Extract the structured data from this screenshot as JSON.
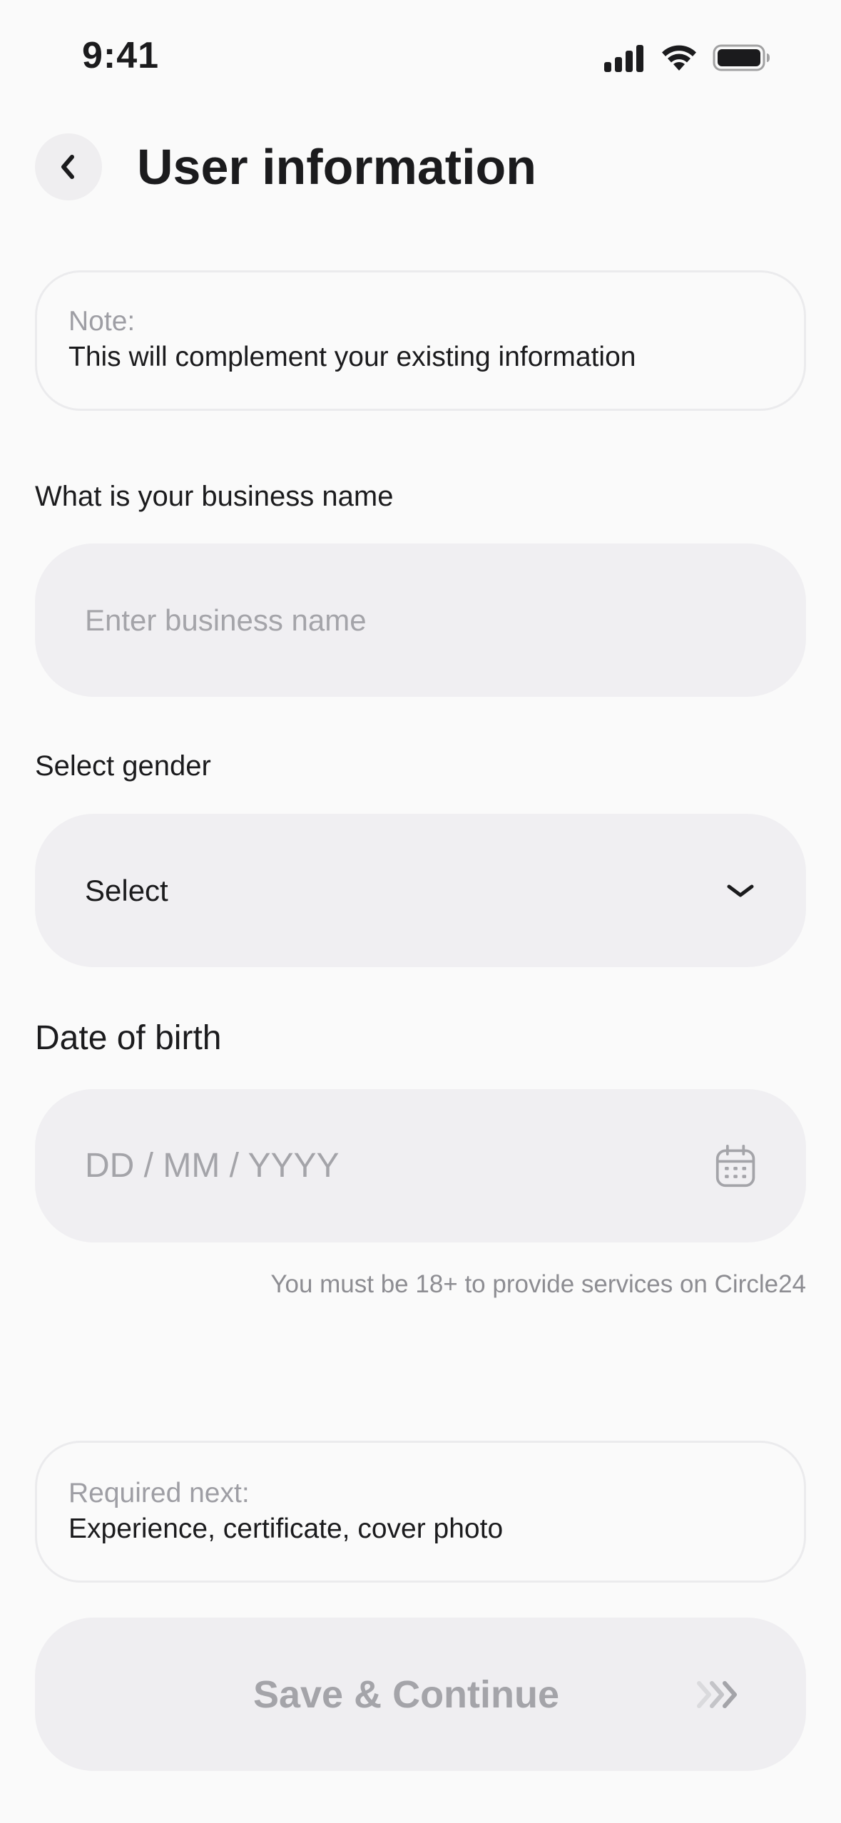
{
  "status_bar": {
    "time": "9:41"
  },
  "header": {
    "title": "User information"
  },
  "note_card": {
    "label": "Note:",
    "text": "This will complement your existing information"
  },
  "business_name": {
    "label": "What is your business name",
    "placeholder": "Enter business name"
  },
  "gender": {
    "label": "Select gender",
    "value": "Select"
  },
  "dob": {
    "label": "Date of birth",
    "placeholder": "DD / MM / YYYY",
    "hint": "You must be 18+ to provide services on Circle24"
  },
  "required_card": {
    "label": "Required next:",
    "text": "Experience, certificate, cover photo"
  },
  "save_button": {
    "label": "Save & Continue"
  },
  "colors": {
    "background": "#fafafa",
    "field": "#f0eff2",
    "disabled_text": "#a4a4a9"
  }
}
